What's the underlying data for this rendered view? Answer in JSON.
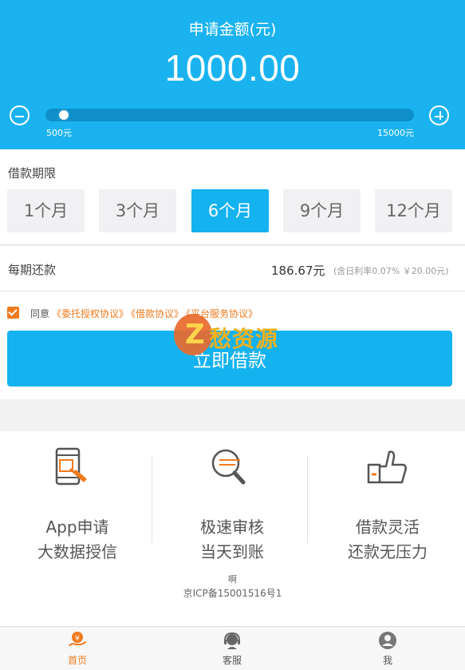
{
  "header": {
    "title": "申请金额(元)",
    "amount": "1000.00",
    "slider": {
      "min_label": "500元",
      "max_label": "15000元",
      "min": 500,
      "max": 15000,
      "value": 1000
    }
  },
  "term": {
    "label": "借款期限",
    "options": [
      "1个月",
      "3个月",
      "6个月",
      "9个月",
      "12个月"
    ],
    "selected": "6个月"
  },
  "repayment": {
    "label": "每期还款",
    "amount": "186.67元",
    "note": "(含日利率0.07% ￥20.00元)"
  },
  "agreement": {
    "checked": true,
    "prefix": "同意",
    "links": [
      "《委托授权协议》",
      "《借款协议》",
      "《平台服务协议》"
    ]
  },
  "submit_label": "立即借款",
  "watermark": {
    "text": "愁资源",
    "bolt": "Z"
  },
  "features": [
    {
      "icon": "phone-tap-icon",
      "line1": "App申请",
      "line2": "大数据授信"
    },
    {
      "icon": "magnifier-icon",
      "line1": "极速审核",
      "line2": "当天到账"
    },
    {
      "icon": "thumbs-up-icon",
      "line1": "借款灵活",
      "line2": "还款无压力"
    }
  ],
  "footer": {
    "line1": "啊",
    "icp": "京ICP备15001516号1"
  },
  "tabbar": [
    {
      "label": "首页",
      "icon": "home-yen-icon",
      "active": true
    },
    {
      "label": "客服",
      "icon": "customer-service-icon",
      "active": false
    },
    {
      "label": "我",
      "icon": "user-icon",
      "active": false
    }
  ],
  "colors": {
    "primary": "#1ab3ef",
    "accent": "#f07a1d",
    "text": "#333333",
    "background": "#f2f2f2"
  }
}
